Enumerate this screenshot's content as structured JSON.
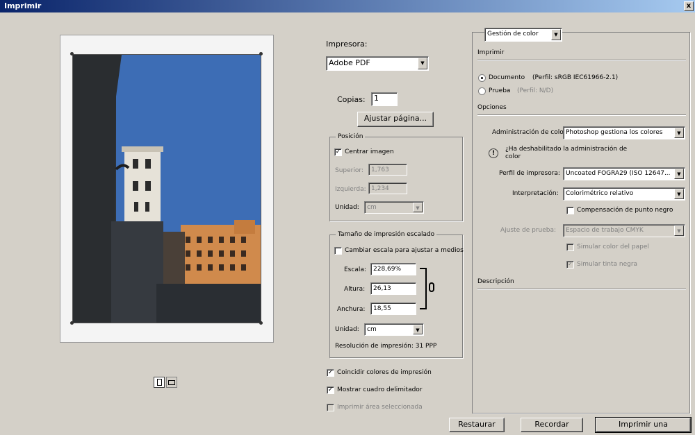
{
  "window": {
    "title": "Imprimir",
    "close": "x"
  },
  "printer": {
    "label": "Impresora:",
    "value": "Adobe PDF"
  },
  "copies": {
    "label": "Copias:",
    "value": "1"
  },
  "page_setup_button": "Ajustar página...",
  "position": {
    "title": "Posición",
    "center_label": "Centrar imagen",
    "top_label": "Superior:",
    "top_value": "1,763",
    "left_label": "Izquierda:",
    "left_value": "1,234",
    "unit_label": "Unidad:",
    "unit_value": "cm"
  },
  "scaled": {
    "title": "Tamaño de impresión escalado",
    "fit_label": "Cambiar escala para ajustar a medios",
    "scale_label": "Escala:",
    "scale_value": "228,69%",
    "height_label": "Altura:",
    "height_value": "26,13",
    "width_label": "Anchura:",
    "width_value": "18,55",
    "unit_label": "Unidad:",
    "unit_value": "cm",
    "resolution": "Resolución de impresión: 31 PPP"
  },
  "options_left": {
    "match_colors": "Coincidir colores de impresión",
    "bounding_box": "Mostrar cuadro delimitador",
    "print_selected": "Imprimir área seleccionada"
  },
  "color_panel": {
    "dropdown": "Gestión de color",
    "print_section": "Imprimir",
    "document_label": "Documento",
    "document_profile": "(Perfil: sRGB IEC61966-2.1)",
    "proof_label": "Prueba",
    "proof_profile": "(Perfil: N/D)",
    "options_section": "Opciones",
    "color_handling_label": "Administración de color:",
    "color_handling_value": "Photoshop gestiona los colores",
    "warning_text": "¿Ha deshabilitado la administración de color",
    "printer_profile_label": "Perfil de impresora:",
    "printer_profile_value": "Uncoated FOGRA29 (ISO 12647...",
    "rendering_label": "Interpretación:",
    "rendering_value": "Colorimétrico relativo",
    "bpc_label": "Compensación de punto negro",
    "proof_setup_label": "Ajuste de prueba:",
    "proof_setup_value": "Espacio de trabajo CMYK",
    "simulate_paper": "Simular color del papel",
    "simulate_ink": "Simular tinta negra",
    "description_section": "Descripción"
  },
  "buttons": {
    "reset": "Restaurar",
    "remember": "Recordar",
    "print_one": "Imprimir una"
  },
  "icons": {
    "check": "✓",
    "arrow": "▼",
    "warning": "!"
  }
}
